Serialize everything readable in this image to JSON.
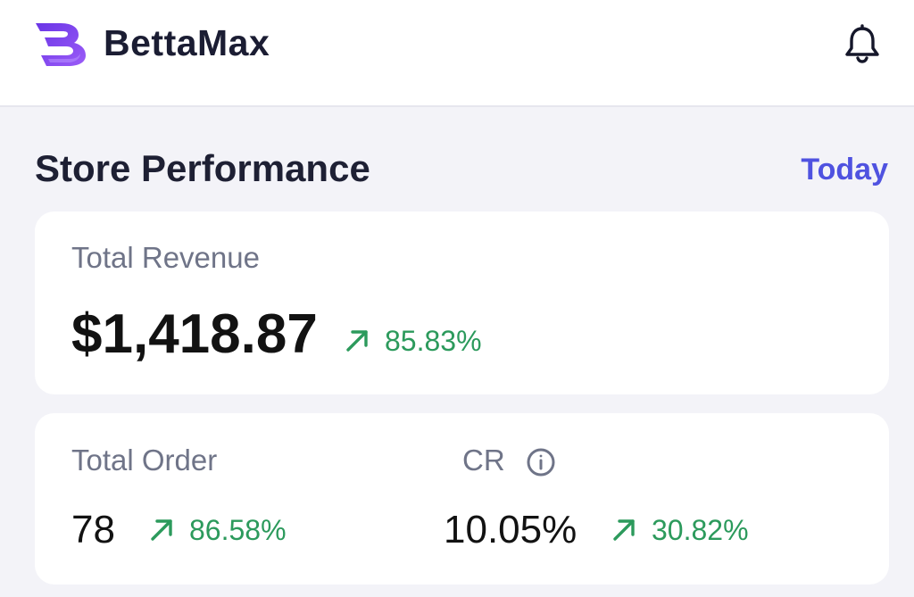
{
  "header": {
    "brand_name": "BettaMax",
    "logo_icon": "bettamax-logo-icon",
    "notification_icon": "bell-icon",
    "accent_color": "#7b3ff2"
  },
  "store_performance": {
    "title": "Store Performance",
    "period_label": "Today",
    "revenue": {
      "label": "Total Revenue",
      "value": "$1,418.87",
      "change": "85.83%"
    },
    "orders": {
      "label": "Total Order",
      "value": "78",
      "change": "86.58%"
    },
    "conversion": {
      "label": "CR",
      "value": "10.05%",
      "change": "30.82%",
      "info_icon": "info-icon"
    },
    "trend_icon": "arrow-up-right-icon",
    "positive_color": "#2c9a5c",
    "link_color": "#4f52e0"
  }
}
